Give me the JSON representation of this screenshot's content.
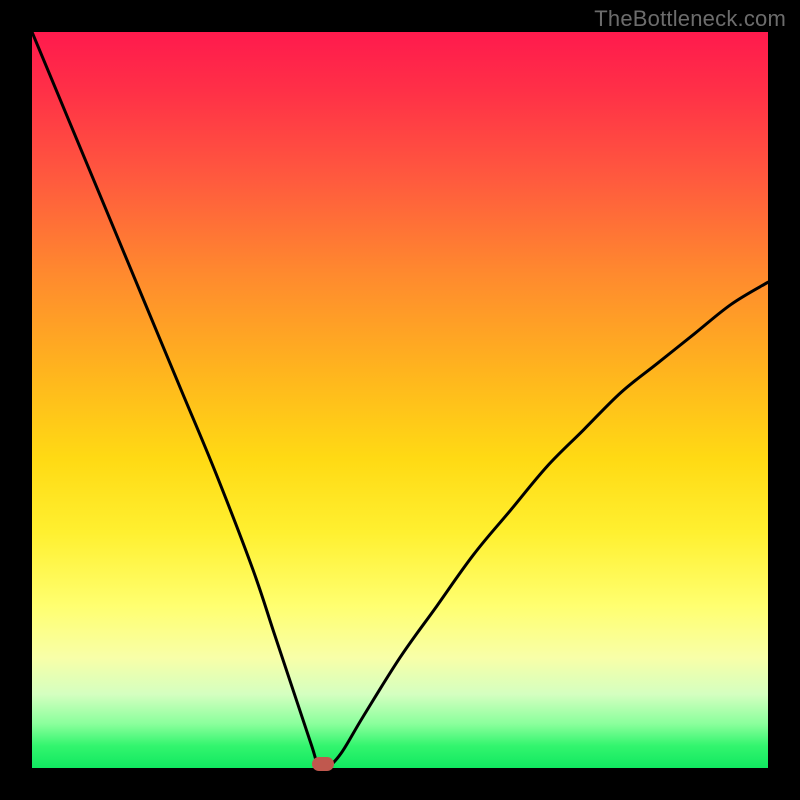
{
  "watermark": "TheBottleneck.com",
  "colors": {
    "frame": "#000000",
    "curve": "#000000",
    "marker": "#c0584e",
    "gradient_top": "#ff1a4d",
    "gradient_bottom": "#10e860"
  },
  "chart_data": {
    "type": "line",
    "title": "",
    "xlabel": "",
    "ylabel": "",
    "xlim": [
      0,
      100
    ],
    "ylim": [
      0,
      100
    ],
    "grid": false,
    "legend": false,
    "series": [
      {
        "name": "bottleneck-curve",
        "x": [
          0,
          5,
          10,
          15,
          20,
          25,
          30,
          33,
          36,
          38,
          39,
          40,
          42,
          45,
          50,
          55,
          60,
          65,
          70,
          75,
          80,
          85,
          90,
          95,
          100
        ],
        "values": [
          100,
          88,
          76,
          64,
          52,
          40,
          27,
          18,
          9,
          3,
          0,
          0,
          2,
          7,
          15,
          22,
          29,
          35,
          41,
          46,
          51,
          55,
          59,
          63,
          66
        ]
      }
    ],
    "marker": {
      "x": 39.5,
      "y": 0
    },
    "background_gradient": {
      "direction": "vertical",
      "stops": [
        {
          "pos": 0.0,
          "color": "#ff1a4d"
        },
        {
          "pos": 0.33,
          "color": "#ff8a2e"
        },
        {
          "pos": 0.58,
          "color": "#ffda14"
        },
        {
          "pos": 0.85,
          "color": "#f8ffa8"
        },
        {
          "pos": 1.0,
          "color": "#10e860"
        }
      ]
    }
  }
}
